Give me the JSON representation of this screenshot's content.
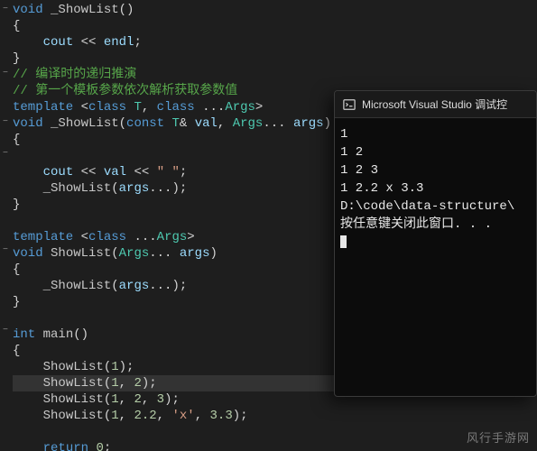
{
  "code": {
    "lines": [
      {
        "fold": "−",
        "tokens": [
          {
            "cls": "tok-kw",
            "t": "void"
          },
          {
            "cls": "tok-punc",
            "t": " "
          },
          {
            "cls": "tok-func",
            "t": "_ShowList"
          },
          {
            "cls": "tok-punc",
            "t": "()"
          }
        ]
      },
      {
        "fold": "",
        "tokens": [
          {
            "cls": "tok-punc",
            "t": "{"
          }
        ]
      },
      {
        "fold": "",
        "tokens": [
          {
            "cls": "tok-punc",
            "t": "    "
          },
          {
            "cls": "tok-var",
            "t": "cout"
          },
          {
            "cls": "tok-punc",
            "t": " "
          },
          {
            "cls": "tok-op",
            "t": "<<"
          },
          {
            "cls": "tok-punc",
            "t": " "
          },
          {
            "cls": "tok-var",
            "t": "endl"
          },
          {
            "cls": "tok-punc",
            "t": ";"
          }
        ]
      },
      {
        "fold": "",
        "tokens": [
          {
            "cls": "tok-punc",
            "t": "}"
          }
        ]
      },
      {
        "fold": "−",
        "tokens": [
          {
            "cls": "tok-comment",
            "t": "// 编译时的递归推演"
          }
        ]
      },
      {
        "fold": "",
        "tokens": [
          {
            "cls": "tok-comment",
            "t": "// 第一个模板参数依次解析获取参数值"
          }
        ]
      },
      {
        "fold": "",
        "tokens": [
          {
            "cls": "tok-kw",
            "t": "template"
          },
          {
            "cls": "tok-punc",
            "t": " <"
          },
          {
            "cls": "tok-kw",
            "t": "class"
          },
          {
            "cls": "tok-punc",
            "t": " "
          },
          {
            "cls": "tok-templ",
            "t": "T"
          },
          {
            "cls": "tok-punc",
            "t": ", "
          },
          {
            "cls": "tok-kw",
            "t": "class"
          },
          {
            "cls": "tok-punc",
            "t": " "
          },
          {
            "cls": "tok-dots",
            "t": "..."
          },
          {
            "cls": "tok-templ",
            "t": "Args"
          },
          {
            "cls": "tok-punc",
            "t": ">"
          }
        ]
      },
      {
        "fold": "−",
        "tokens": [
          {
            "cls": "tok-kw",
            "t": "void"
          },
          {
            "cls": "tok-punc",
            "t": " "
          },
          {
            "cls": "tok-func",
            "t": "_ShowList"
          },
          {
            "cls": "tok-punc",
            "t": "("
          },
          {
            "cls": "tok-kw",
            "t": "const"
          },
          {
            "cls": "tok-punc",
            "t": " "
          },
          {
            "cls": "tok-templ",
            "t": "T"
          },
          {
            "cls": "tok-punc",
            "t": "& "
          },
          {
            "cls": "tok-var",
            "t": "val"
          },
          {
            "cls": "tok-punc",
            "t": ", "
          },
          {
            "cls": "tok-templ",
            "t": "Args"
          },
          {
            "cls": "tok-dots",
            "t": "..."
          },
          {
            "cls": "tok-punc",
            "t": " "
          },
          {
            "cls": "tok-var",
            "t": "args"
          },
          {
            "cls": "tok-punc",
            "t": ")"
          }
        ]
      },
      {
        "fold": "",
        "tokens": [
          {
            "cls": "tok-punc",
            "t": "{"
          }
        ]
      },
      {
        "fold": "−",
        "tokens": []
      },
      {
        "fold": "",
        "tokens": [
          {
            "cls": "tok-punc",
            "t": "    "
          },
          {
            "cls": "tok-var",
            "t": "cout"
          },
          {
            "cls": "tok-punc",
            "t": " "
          },
          {
            "cls": "tok-op",
            "t": "<<"
          },
          {
            "cls": "tok-punc",
            "t": " "
          },
          {
            "cls": "tok-var",
            "t": "val"
          },
          {
            "cls": "tok-punc",
            "t": " "
          },
          {
            "cls": "tok-op",
            "t": "<<"
          },
          {
            "cls": "tok-punc",
            "t": " "
          },
          {
            "cls": "tok-str",
            "t": "\" \""
          },
          {
            "cls": "tok-punc",
            "t": ";"
          }
        ]
      },
      {
        "fold": "",
        "tokens": [
          {
            "cls": "tok-punc",
            "t": "    "
          },
          {
            "cls": "tok-func",
            "t": "_ShowList"
          },
          {
            "cls": "tok-punc",
            "t": "("
          },
          {
            "cls": "tok-var",
            "t": "args"
          },
          {
            "cls": "tok-dots",
            "t": "..."
          },
          {
            "cls": "tok-punc",
            "t": ");"
          }
        ]
      },
      {
        "fold": "",
        "tokens": [
          {
            "cls": "tok-punc",
            "t": "}"
          }
        ]
      },
      {
        "fold": "",
        "tokens": []
      },
      {
        "fold": "",
        "tokens": [
          {
            "cls": "tok-kw",
            "t": "template"
          },
          {
            "cls": "tok-punc",
            "t": " <"
          },
          {
            "cls": "tok-kw",
            "t": "class"
          },
          {
            "cls": "tok-punc",
            "t": " "
          },
          {
            "cls": "tok-dots",
            "t": "..."
          },
          {
            "cls": "tok-templ",
            "t": "Args"
          },
          {
            "cls": "tok-punc",
            "t": ">"
          }
        ]
      },
      {
        "fold": "−",
        "tokens": [
          {
            "cls": "tok-kw",
            "t": "void"
          },
          {
            "cls": "tok-punc",
            "t": " "
          },
          {
            "cls": "tok-func",
            "t": "ShowList"
          },
          {
            "cls": "tok-punc",
            "t": "("
          },
          {
            "cls": "tok-templ",
            "t": "Args"
          },
          {
            "cls": "tok-dots",
            "t": "..."
          },
          {
            "cls": "tok-punc",
            "t": " "
          },
          {
            "cls": "tok-var",
            "t": "args"
          },
          {
            "cls": "tok-punc",
            "t": ")"
          }
        ]
      },
      {
        "fold": "",
        "tokens": [
          {
            "cls": "tok-punc",
            "t": "{"
          }
        ]
      },
      {
        "fold": "",
        "tokens": [
          {
            "cls": "tok-punc",
            "t": "    "
          },
          {
            "cls": "tok-func",
            "t": "_ShowList"
          },
          {
            "cls": "tok-punc",
            "t": "("
          },
          {
            "cls": "tok-var",
            "t": "args"
          },
          {
            "cls": "tok-dots",
            "t": "..."
          },
          {
            "cls": "tok-punc",
            "t": ");"
          }
        ]
      },
      {
        "fold": "",
        "tokens": [
          {
            "cls": "tok-punc",
            "t": "}"
          }
        ]
      },
      {
        "fold": "",
        "tokens": []
      },
      {
        "fold": "−",
        "tokens": [
          {
            "cls": "tok-kw",
            "t": "int"
          },
          {
            "cls": "tok-punc",
            "t": " "
          },
          {
            "cls": "tok-func",
            "t": "main"
          },
          {
            "cls": "tok-punc",
            "t": "()"
          }
        ]
      },
      {
        "fold": "",
        "tokens": [
          {
            "cls": "tok-punc",
            "t": "{"
          }
        ]
      },
      {
        "fold": "",
        "tokens": [
          {
            "cls": "tok-punc",
            "t": "    "
          },
          {
            "cls": "tok-func",
            "t": "ShowList"
          },
          {
            "cls": "tok-punc",
            "t": "("
          },
          {
            "cls": "tok-num",
            "t": "1"
          },
          {
            "cls": "tok-punc",
            "t": ");"
          }
        ]
      },
      {
        "fold": "",
        "highlight": true,
        "tokens": [
          {
            "cls": "tok-punc",
            "t": "    "
          },
          {
            "cls": "tok-func",
            "t": "ShowList"
          },
          {
            "cls": "tok-punc",
            "t": "("
          },
          {
            "cls": "tok-num",
            "t": "1"
          },
          {
            "cls": "tok-punc",
            "t": ", "
          },
          {
            "cls": "tok-num",
            "t": "2"
          },
          {
            "cls": "tok-punc",
            "t": ");"
          }
        ]
      },
      {
        "fold": "",
        "tokens": [
          {
            "cls": "tok-punc",
            "t": "    "
          },
          {
            "cls": "tok-func",
            "t": "ShowList"
          },
          {
            "cls": "tok-punc",
            "t": "("
          },
          {
            "cls": "tok-num",
            "t": "1"
          },
          {
            "cls": "tok-punc",
            "t": ", "
          },
          {
            "cls": "tok-num",
            "t": "2"
          },
          {
            "cls": "tok-punc",
            "t": ", "
          },
          {
            "cls": "tok-num",
            "t": "3"
          },
          {
            "cls": "tok-punc",
            "t": ");"
          }
        ]
      },
      {
        "fold": "",
        "tokens": [
          {
            "cls": "tok-punc",
            "t": "    "
          },
          {
            "cls": "tok-func",
            "t": "ShowList"
          },
          {
            "cls": "tok-punc",
            "t": "("
          },
          {
            "cls": "tok-num",
            "t": "1"
          },
          {
            "cls": "tok-punc",
            "t": ", "
          },
          {
            "cls": "tok-num",
            "t": "2.2"
          },
          {
            "cls": "tok-punc",
            "t": ", "
          },
          {
            "cls": "tok-str",
            "t": "'x'"
          },
          {
            "cls": "tok-punc",
            "t": ", "
          },
          {
            "cls": "tok-num",
            "t": "3.3"
          },
          {
            "cls": "tok-punc",
            "t": ");"
          }
        ]
      },
      {
        "fold": "",
        "tokens": []
      },
      {
        "fold": "",
        "tokens": [
          {
            "cls": "tok-punc",
            "t": "    "
          },
          {
            "cls": "tok-kw",
            "t": "return"
          },
          {
            "cls": "tok-punc",
            "t": " "
          },
          {
            "cls": "tok-num",
            "t": "0"
          },
          {
            "cls": "tok-punc",
            "t": ";"
          }
        ]
      }
    ]
  },
  "console": {
    "title": "Microsoft Visual Studio 调试控",
    "out_lines": [
      "1",
      "1 2",
      "1 2 3",
      "1 2.2 x 3.3",
      "",
      "D:\\code\\data-structure\\",
      "",
      "按任意键关闭此窗口. . ."
    ]
  },
  "watermark": "风行手游网"
}
